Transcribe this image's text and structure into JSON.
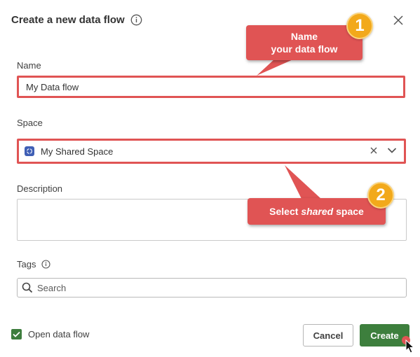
{
  "dialog": {
    "title": "Create a new data flow"
  },
  "form": {
    "name_label": "Name",
    "name_value": "My Data flow",
    "space_label": "Space",
    "space_value": "My Shared Space",
    "description_label": "Description",
    "tags_label": "Tags",
    "tags_placeholder": "Search"
  },
  "footer": {
    "open_data_flow_label": "Open data flow",
    "open_data_flow_checked": true,
    "cancel_label": "Cancel",
    "create_label": "Create"
  },
  "annotations": {
    "callout1_line1": "Name",
    "callout1_line2": "your data flow",
    "callout2_prefix": "Select ",
    "callout2_emphasis": "shared",
    "callout2_suffix": " space",
    "badge1": "1",
    "badge2": "2"
  },
  "colors": {
    "highlight": "#e05454",
    "primary_button": "#3d7f3d",
    "badge": "#f2a91b",
    "space_icon": "#3f5fb5"
  },
  "icons": {
    "title_info": "info-icon",
    "close": "close-icon",
    "space": "space-icon",
    "clear": "clear-icon",
    "dropdown": "chevron-down-icon",
    "search": "search-icon",
    "tags_info": "info-icon",
    "checkbox": "checkmark-icon",
    "cursor": "mouse-pointer-icon"
  }
}
